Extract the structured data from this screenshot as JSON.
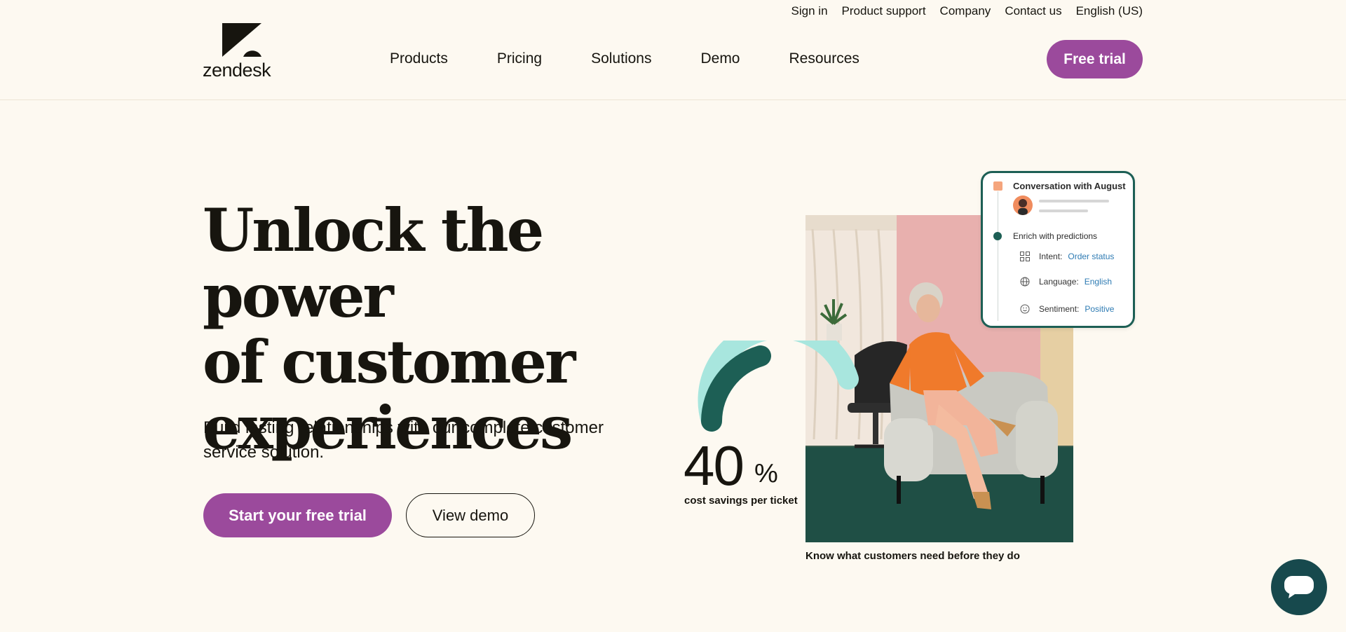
{
  "utility_nav": {
    "sign_in": "Sign in",
    "product_support": "Product support",
    "company": "Company",
    "contact_us": "Contact us",
    "language": "English (US)"
  },
  "brand": {
    "logo_text": "zendesk"
  },
  "main_nav": {
    "items": [
      "Products",
      "Pricing",
      "Solutions",
      "Demo",
      "Resources"
    ],
    "free_trial_label": "Free trial"
  },
  "hero": {
    "title_lines": [
      "Unlock the power",
      "of customer",
      "experiences"
    ],
    "subtitle": "Build lasting relationships with our complete customer service solution.",
    "primary_cta": "Start your free trial",
    "secondary_cta": "View demo"
  },
  "stat": {
    "value": "40",
    "unit": "%",
    "label": "cost savings per ticket"
  },
  "photo_caption": "Know what customers need before they do",
  "prediction_card": {
    "title": "Conversation with August",
    "enrich_label": "Enrich with predictions",
    "intent_label": "Intent:",
    "intent_value": "Order status",
    "language_label": "Language:",
    "language_value": "English",
    "sentiment_label": "Sentiment:",
    "sentiment_value": "Positive"
  },
  "colors": {
    "background": "#fdf9f1",
    "brand_purple": "#9b4a9c",
    "teal_dark": "#1d5f55",
    "teal_light": "#a8e6de",
    "link_blue": "#2e7bb3"
  },
  "icons": {
    "chat_launcher": "chat-bubble-icon",
    "intent": "grid-icon",
    "language": "globe-icon",
    "sentiment": "smiley-icon"
  }
}
